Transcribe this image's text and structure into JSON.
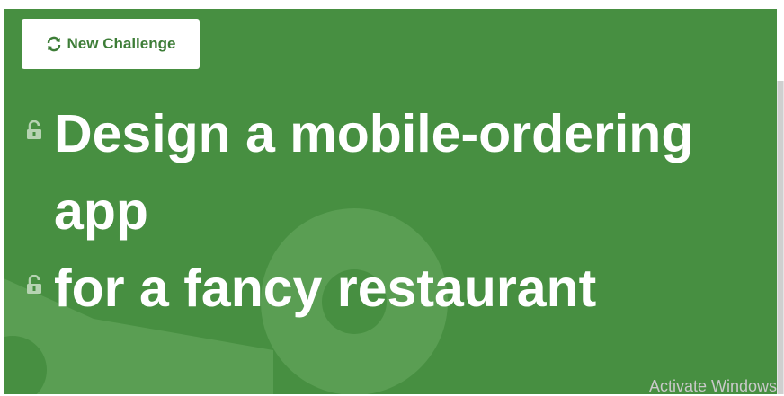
{
  "toolbar": {
    "new_challenge_label": "New Challenge",
    "refresh_icon": "refresh-icon"
  },
  "challenge": {
    "lines": [
      {
        "text": "Design a mobile-ordering app",
        "icon": "unlocked-lock-icon"
      },
      {
        "text": "for a fancy restaurant",
        "icon": "unlocked-lock-icon"
      }
    ]
  },
  "watermark": "Activate Windows",
  "colors": {
    "panel": "#478f41",
    "button_text": "#3d7d37",
    "text": "#ffffff",
    "watermark": "#c9c9c9"
  }
}
